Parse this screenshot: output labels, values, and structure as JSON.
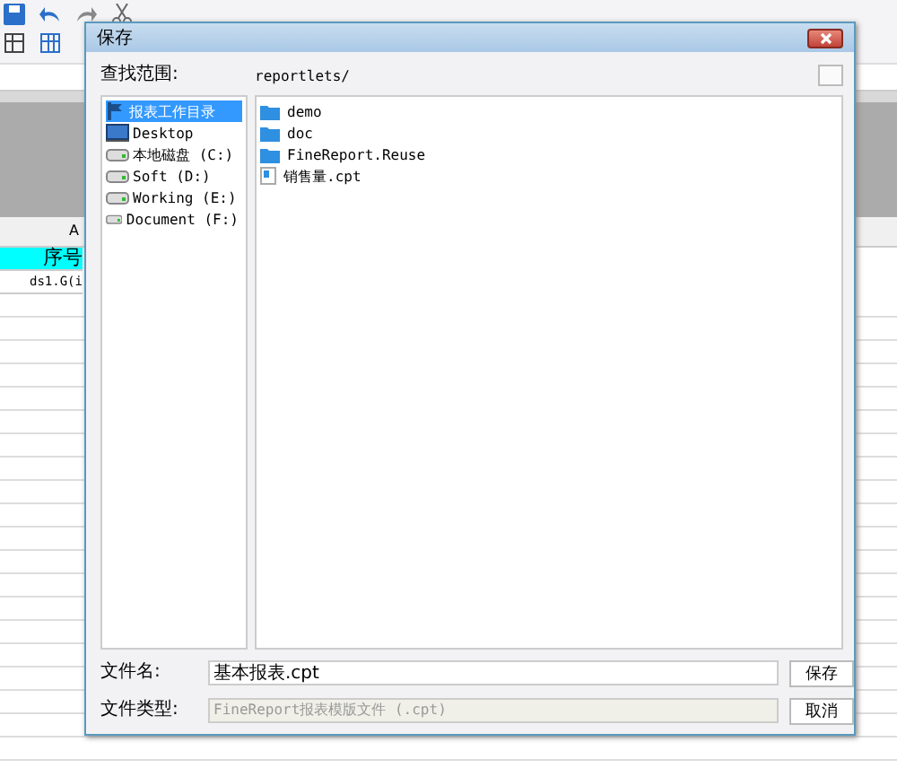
{
  "sheet": {
    "column_header": "A",
    "rows": [
      {
        "text": "序号",
        "kind": "header"
      },
      {
        "text": "ds1.G(i",
        "kind": "formula"
      }
    ]
  },
  "dialog": {
    "title": "保存",
    "look_in_label": "查找范围:",
    "path": "reportlets/",
    "places": [
      {
        "label": "报表工作目录",
        "kind": "workdir",
        "selected": true
      },
      {
        "label": "Desktop",
        "kind": "desktop",
        "selected": false
      },
      {
        "label": "本地磁盘 (C:)",
        "kind": "drive",
        "selected": false
      },
      {
        "label": "Soft (D:)",
        "kind": "drive",
        "selected": false
      },
      {
        "label": "Working (E:)",
        "kind": "drive",
        "selected": false
      },
      {
        "label": "Document (F:)",
        "kind": "drive",
        "selected": false
      }
    ],
    "files": [
      {
        "name": "demo",
        "kind": "folder"
      },
      {
        "name": "doc",
        "kind": "folder"
      },
      {
        "name": "FineReport.Reuse",
        "kind": "folder"
      },
      {
        "name": "销售量.cpt",
        "kind": "report"
      }
    ],
    "filename_label": "文件名:",
    "filename": "基本报表.cpt",
    "filetype_label": "文件类型:",
    "filetype": "FineReport报表模版文件 (.cpt)",
    "filetype_disabled": true,
    "buttons": [
      "保存",
      "取消"
    ]
  }
}
